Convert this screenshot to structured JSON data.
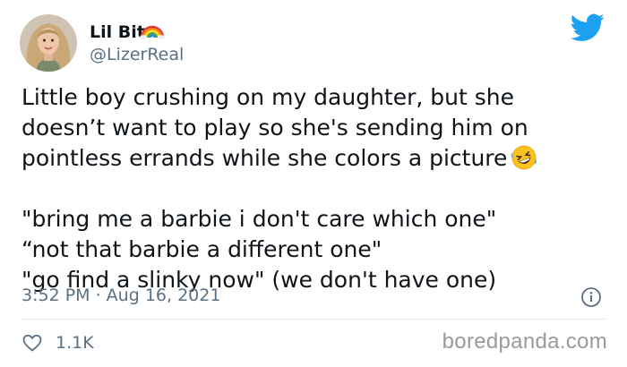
{
  "author": {
    "display_name": "Lil Bit",
    "handle": "@LizerReal",
    "avatar_icon": "profile-photo",
    "name_emoji": "rainbow-emoji"
  },
  "tweet": {
    "lines": [
      "Little boy crushing on my daughter, but she",
      "doesn’t want to play so she's sending him on",
      "pointless errands while she colors a picture"
    ],
    "emoji": "rolling-on-floor-laughing-emoji",
    "quotes": [
      "\"bring me a barbie i don't care which one\"",
      "“not that barbie a different one\"",
      "\"go find a slinky now\" (we don't have one)"
    ],
    "timestamp": "3:52 PM · Aug 16, 2021"
  },
  "actions": {
    "like_count": "1.1K",
    "like_icon": "heart-icon",
    "info_icon": "info-icon"
  },
  "watermark": "boredpanda.com",
  "colors": {
    "twitter_blue": "#1da1f2",
    "secondary_text": "#5b7083",
    "primary_text": "#0f1419"
  }
}
